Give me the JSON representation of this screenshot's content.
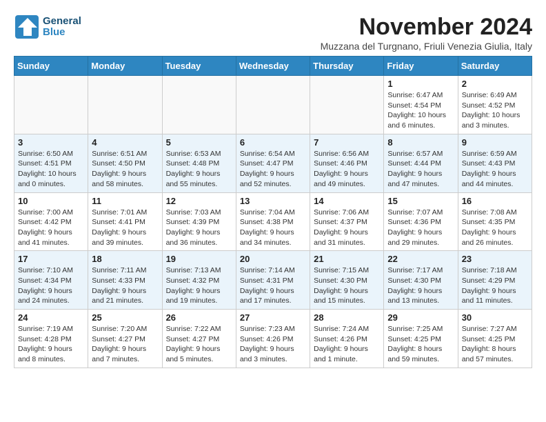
{
  "header": {
    "logo_line1": "General",
    "logo_line2": "Blue",
    "month_title": "November 2024",
    "location": "Muzzana del Turgnano, Friuli Venezia Giulia, Italy"
  },
  "weekdays": [
    "Sunday",
    "Monday",
    "Tuesday",
    "Wednesday",
    "Thursday",
    "Friday",
    "Saturday"
  ],
  "weeks": [
    [
      {
        "day": "",
        "info": ""
      },
      {
        "day": "",
        "info": ""
      },
      {
        "day": "",
        "info": ""
      },
      {
        "day": "",
        "info": ""
      },
      {
        "day": "",
        "info": ""
      },
      {
        "day": "1",
        "info": "Sunrise: 6:47 AM\nSunset: 4:54 PM\nDaylight: 10 hours\nand 6 minutes."
      },
      {
        "day": "2",
        "info": "Sunrise: 6:49 AM\nSunset: 4:52 PM\nDaylight: 10 hours\nand 3 minutes."
      }
    ],
    [
      {
        "day": "3",
        "info": "Sunrise: 6:50 AM\nSunset: 4:51 PM\nDaylight: 10 hours\nand 0 minutes."
      },
      {
        "day": "4",
        "info": "Sunrise: 6:51 AM\nSunset: 4:50 PM\nDaylight: 9 hours\nand 58 minutes."
      },
      {
        "day": "5",
        "info": "Sunrise: 6:53 AM\nSunset: 4:48 PM\nDaylight: 9 hours\nand 55 minutes."
      },
      {
        "day": "6",
        "info": "Sunrise: 6:54 AM\nSunset: 4:47 PM\nDaylight: 9 hours\nand 52 minutes."
      },
      {
        "day": "7",
        "info": "Sunrise: 6:56 AM\nSunset: 4:46 PM\nDaylight: 9 hours\nand 49 minutes."
      },
      {
        "day": "8",
        "info": "Sunrise: 6:57 AM\nSunset: 4:44 PM\nDaylight: 9 hours\nand 47 minutes."
      },
      {
        "day": "9",
        "info": "Sunrise: 6:59 AM\nSunset: 4:43 PM\nDaylight: 9 hours\nand 44 minutes."
      }
    ],
    [
      {
        "day": "10",
        "info": "Sunrise: 7:00 AM\nSunset: 4:42 PM\nDaylight: 9 hours\nand 41 minutes."
      },
      {
        "day": "11",
        "info": "Sunrise: 7:01 AM\nSunset: 4:41 PM\nDaylight: 9 hours\nand 39 minutes."
      },
      {
        "day": "12",
        "info": "Sunrise: 7:03 AM\nSunset: 4:39 PM\nDaylight: 9 hours\nand 36 minutes."
      },
      {
        "day": "13",
        "info": "Sunrise: 7:04 AM\nSunset: 4:38 PM\nDaylight: 9 hours\nand 34 minutes."
      },
      {
        "day": "14",
        "info": "Sunrise: 7:06 AM\nSunset: 4:37 PM\nDaylight: 9 hours\nand 31 minutes."
      },
      {
        "day": "15",
        "info": "Sunrise: 7:07 AM\nSunset: 4:36 PM\nDaylight: 9 hours\nand 29 minutes."
      },
      {
        "day": "16",
        "info": "Sunrise: 7:08 AM\nSunset: 4:35 PM\nDaylight: 9 hours\nand 26 minutes."
      }
    ],
    [
      {
        "day": "17",
        "info": "Sunrise: 7:10 AM\nSunset: 4:34 PM\nDaylight: 9 hours\nand 24 minutes."
      },
      {
        "day": "18",
        "info": "Sunrise: 7:11 AM\nSunset: 4:33 PM\nDaylight: 9 hours\nand 21 minutes."
      },
      {
        "day": "19",
        "info": "Sunrise: 7:13 AM\nSunset: 4:32 PM\nDaylight: 9 hours\nand 19 minutes."
      },
      {
        "day": "20",
        "info": "Sunrise: 7:14 AM\nSunset: 4:31 PM\nDaylight: 9 hours\nand 17 minutes."
      },
      {
        "day": "21",
        "info": "Sunrise: 7:15 AM\nSunset: 4:30 PM\nDaylight: 9 hours\nand 15 minutes."
      },
      {
        "day": "22",
        "info": "Sunrise: 7:17 AM\nSunset: 4:30 PM\nDaylight: 9 hours\nand 13 minutes."
      },
      {
        "day": "23",
        "info": "Sunrise: 7:18 AM\nSunset: 4:29 PM\nDaylight: 9 hours\nand 11 minutes."
      }
    ],
    [
      {
        "day": "24",
        "info": "Sunrise: 7:19 AM\nSunset: 4:28 PM\nDaylight: 9 hours\nand 8 minutes."
      },
      {
        "day": "25",
        "info": "Sunrise: 7:20 AM\nSunset: 4:27 PM\nDaylight: 9 hours\nand 7 minutes."
      },
      {
        "day": "26",
        "info": "Sunrise: 7:22 AM\nSunset: 4:27 PM\nDaylight: 9 hours\nand 5 minutes."
      },
      {
        "day": "27",
        "info": "Sunrise: 7:23 AM\nSunset: 4:26 PM\nDaylight: 9 hours\nand 3 minutes."
      },
      {
        "day": "28",
        "info": "Sunrise: 7:24 AM\nSunset: 4:26 PM\nDaylight: 9 hours\nand 1 minute."
      },
      {
        "day": "29",
        "info": "Sunrise: 7:25 AM\nSunset: 4:25 PM\nDaylight: 8 hours\nand 59 minutes."
      },
      {
        "day": "30",
        "info": "Sunrise: 7:27 AM\nSunset: 4:25 PM\nDaylight: 8 hours\nand 57 minutes."
      }
    ]
  ]
}
